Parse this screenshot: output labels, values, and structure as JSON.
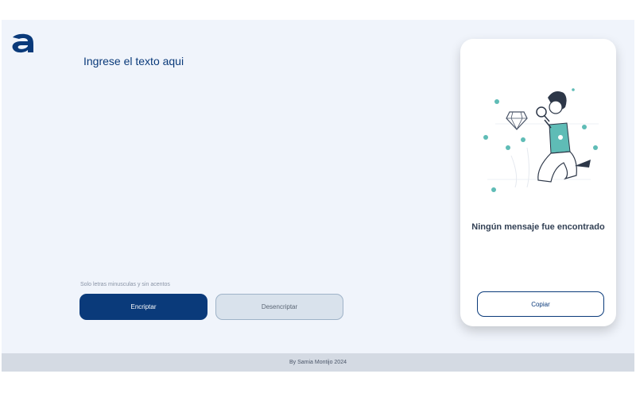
{
  "brand": {
    "logo_icon": "letter-a-logo",
    "accent": "#0a3a7a"
  },
  "input": {
    "placeholder": "Ingrese el texto aqui"
  },
  "hint": "Solo letras minusculas y sin acentos",
  "buttons": {
    "encrypt_label": "Encriptar",
    "decrypt_label": "Desencriptar"
  },
  "result_panel": {
    "illustration_icon": "person-searching-illustration",
    "empty_message": "Ningún mensaje fue encontrado",
    "copy_label": "Copiar"
  },
  "footer": {
    "text": "By Samia Montijo 2024"
  }
}
